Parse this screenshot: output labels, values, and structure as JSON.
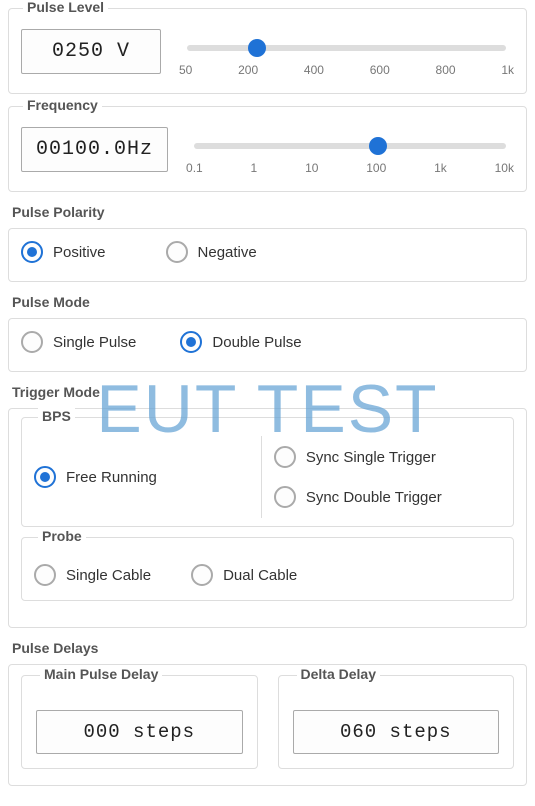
{
  "pulse_level": {
    "label": "Pulse Level",
    "value": "0250 V",
    "ticks": [
      "50",
      "200",
      "400",
      "600",
      "800",
      "1k"
    ],
    "thumb_percent": 22
  },
  "frequency": {
    "label": "Frequency",
    "value": "00100.0Hz",
    "ticks": [
      "0.1",
      "1",
      "10",
      "100",
      "1k",
      "10k"
    ],
    "thumb_percent": 59
  },
  "pulse_polarity": {
    "label": "Pulse Polarity",
    "options": {
      "positive": "Positive",
      "negative": "Negative"
    },
    "selected": "positive"
  },
  "pulse_mode": {
    "label": "Pulse Mode",
    "options": {
      "single": "Single Pulse",
      "double": "Double Pulse"
    },
    "selected": "double"
  },
  "trigger_mode": {
    "label": "Trigger Mode",
    "bps": {
      "label": "BPS",
      "options": {
        "free": "Free Running",
        "sync_single": "Sync Single Trigger",
        "sync_double": "Sync Double Trigger"
      },
      "selected": "free"
    },
    "probe": {
      "label": "Probe",
      "options": {
        "single": "Single Cable",
        "dual": "Dual Cable"
      },
      "selected": ""
    }
  },
  "pulse_delays": {
    "label": "Pulse Delays",
    "main": {
      "label": "Main Pulse Delay",
      "value": "000 steps"
    },
    "delta": {
      "label": "Delta Delay",
      "value": "060 steps"
    }
  },
  "watermark": "EUT TEST"
}
